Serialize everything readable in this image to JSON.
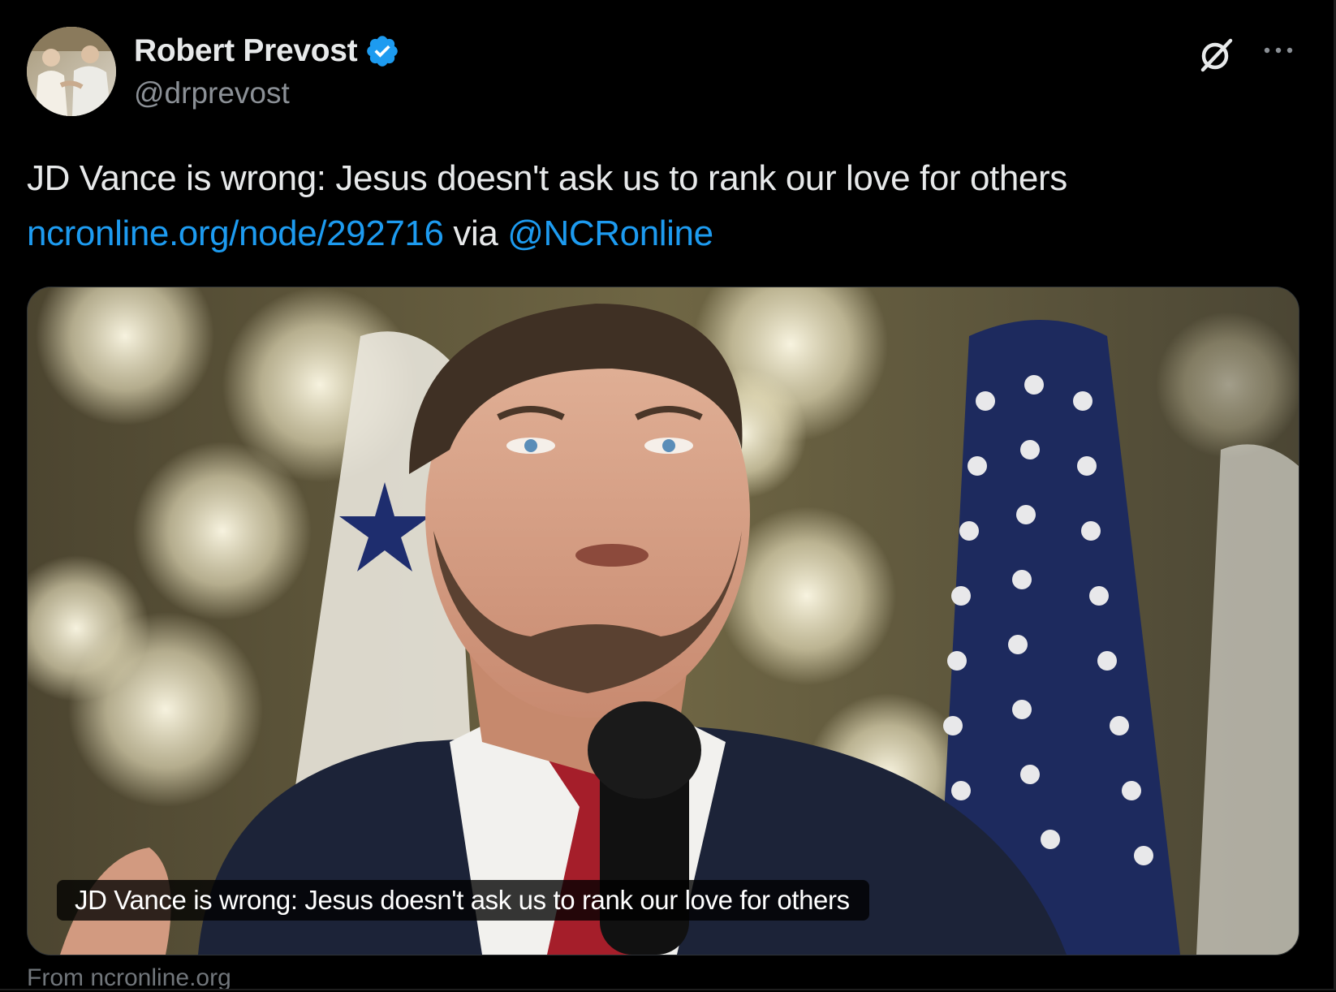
{
  "tweet": {
    "author": {
      "display_name": "Robert Prevost",
      "handle": "@drprevost",
      "verified": true,
      "verified_color": "#1d9bf0"
    },
    "text_before": "JD Vance is wrong: Jesus doesn't ask us to rank our love for others",
    "link_url": "ncronline.org/node/292716",
    "via_text": "via",
    "mention": "@NCRonline",
    "card": {
      "image_alt": "",
      "caption": "JD Vance is wrong: Jesus doesn't ask us to rank our love for others",
      "source": "From ncronline.org"
    },
    "icons": {
      "grok": "grok-icon",
      "more": "more-icon",
      "verified": "verified-badge-icon"
    },
    "colors": {
      "background": "#000000",
      "text": "#e7e9ea",
      "secondary_text": "#8b9096",
      "link": "#1d9bf0"
    }
  }
}
